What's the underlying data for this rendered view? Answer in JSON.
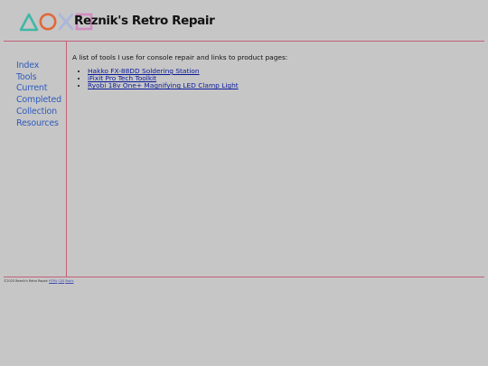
{
  "site": {
    "title": "Reznik's Retro Repair",
    "logo_shapes": [
      "triangle-icon",
      "circle-icon",
      "cross-icon",
      "square-icon"
    ]
  },
  "colors": {
    "background": "#c6c6c6",
    "rule": "#c2617a",
    "nav_link": "#2e5bbf",
    "link": "#0a1a9a",
    "triangle": "#3fb8a6",
    "circle": "#e0683a",
    "cross": "#aab6dc",
    "square": "#d08cbf"
  },
  "nav": {
    "items": [
      {
        "label": "Index"
      },
      {
        "label": "Tools"
      },
      {
        "label": "Current"
      },
      {
        "label": "Completed"
      },
      {
        "label": "Collection"
      },
      {
        "label": "Resources"
      }
    ]
  },
  "main": {
    "intro": "A list of tools I use for console repair and links to product pages:",
    "tools": [
      {
        "label": "Hakko FX-88DD Soldering Station"
      },
      {
        "label": "iFixit Pro Tech Toolkit"
      },
      {
        "label": "Ryobi 18v One+ Magnifying LED Clamp Light"
      }
    ]
  },
  "footer": {
    "copyright": "©2025 Reznik's Retro Repair",
    "links": [
      "HTML",
      "CSS",
      "Rob's"
    ]
  }
}
